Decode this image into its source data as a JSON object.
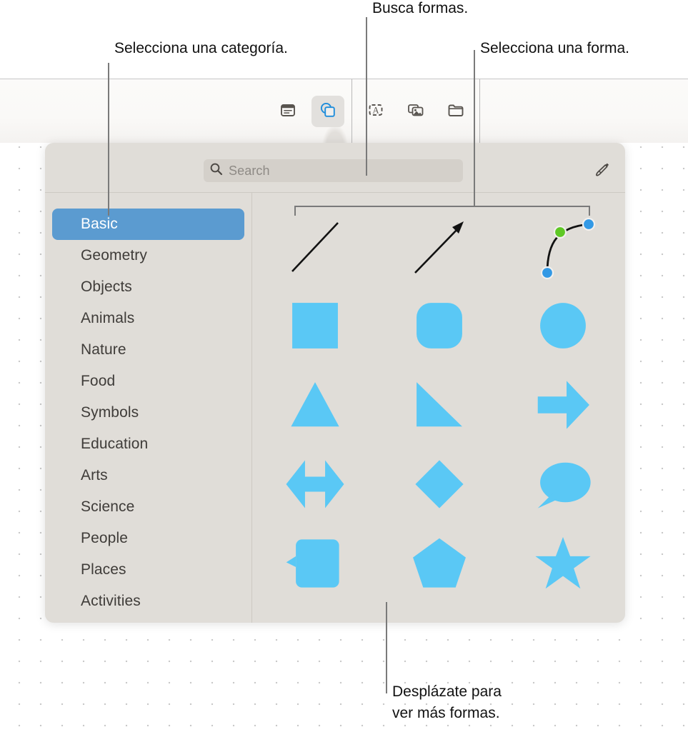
{
  "callouts": {
    "category": {
      "text": "Selecciona una categoría."
    },
    "search": {
      "text": "Busca formas."
    },
    "shape": {
      "text": "Selecciona una forma."
    },
    "scroll": {
      "line1": "Desplázate para",
      "line2": "ver más formas."
    }
  },
  "toolbar": {
    "buttons": [
      {
        "name": "table-icon",
        "label": "Tabla"
      },
      {
        "name": "shapes-icon",
        "label": "Formas",
        "active": true
      },
      {
        "name": "text-box-icon",
        "label": "Cuadro de texto"
      },
      {
        "name": "media-icon",
        "label": "Multimedia"
      },
      {
        "name": "folder-icon",
        "label": "Carpeta"
      }
    ]
  },
  "panel": {
    "search": {
      "placeholder": "Search",
      "value": ""
    },
    "draw_button_label": "Dibujar",
    "categories": [
      {
        "label": "Basic",
        "selected": true
      },
      {
        "label": "Geometry",
        "selected": false
      },
      {
        "label": "Objects",
        "selected": false
      },
      {
        "label": "Animals",
        "selected": false
      },
      {
        "label": "Nature",
        "selected": false
      },
      {
        "label": "Food",
        "selected": false
      },
      {
        "label": "Symbols",
        "selected": false
      },
      {
        "label": "Education",
        "selected": false
      },
      {
        "label": "Arts",
        "selected": false
      },
      {
        "label": "Science",
        "selected": false
      },
      {
        "label": "People",
        "selected": false
      },
      {
        "label": "Places",
        "selected": false
      },
      {
        "label": "Activities",
        "selected": false
      }
    ],
    "shapes": [
      [
        {
          "name": "line-shape",
          "label": "Línea"
        },
        {
          "name": "arrow-line-shape",
          "label": "Línea con flecha"
        },
        {
          "name": "bezier-curve-shape",
          "label": "Curva"
        }
      ],
      [
        {
          "name": "square-shape",
          "label": "Cuadrado"
        },
        {
          "name": "rounded-square-shape",
          "label": "Cuadrado redondeado"
        },
        {
          "name": "circle-shape",
          "label": "Círculo"
        }
      ],
      [
        {
          "name": "triangle-shape",
          "label": "Triángulo"
        },
        {
          "name": "right-triangle-shape",
          "label": "Triángulo rectángulo"
        },
        {
          "name": "right-arrow-shape",
          "label": "Flecha derecha"
        }
      ],
      [
        {
          "name": "double-arrow-shape",
          "label": "Flecha doble"
        },
        {
          "name": "diamond-shape",
          "label": "Rombo"
        },
        {
          "name": "speech-bubble-shape",
          "label": "Bocadillo"
        }
      ],
      [
        {
          "name": "rect-callout-shape",
          "label": "Globo rectangular"
        },
        {
          "name": "pentagon-shape",
          "label": "Pentágono"
        },
        {
          "name": "star-shape",
          "label": "Estrella"
        }
      ]
    ]
  },
  "colors": {
    "shape_blue": "#5AC8F5",
    "selection_blue": "#5B9BD0",
    "panel_background": "#E0DDD8",
    "handle_blue": "#3399E5",
    "handle_green": "#5FC825",
    "leader_gray": "#7A7A7A"
  }
}
